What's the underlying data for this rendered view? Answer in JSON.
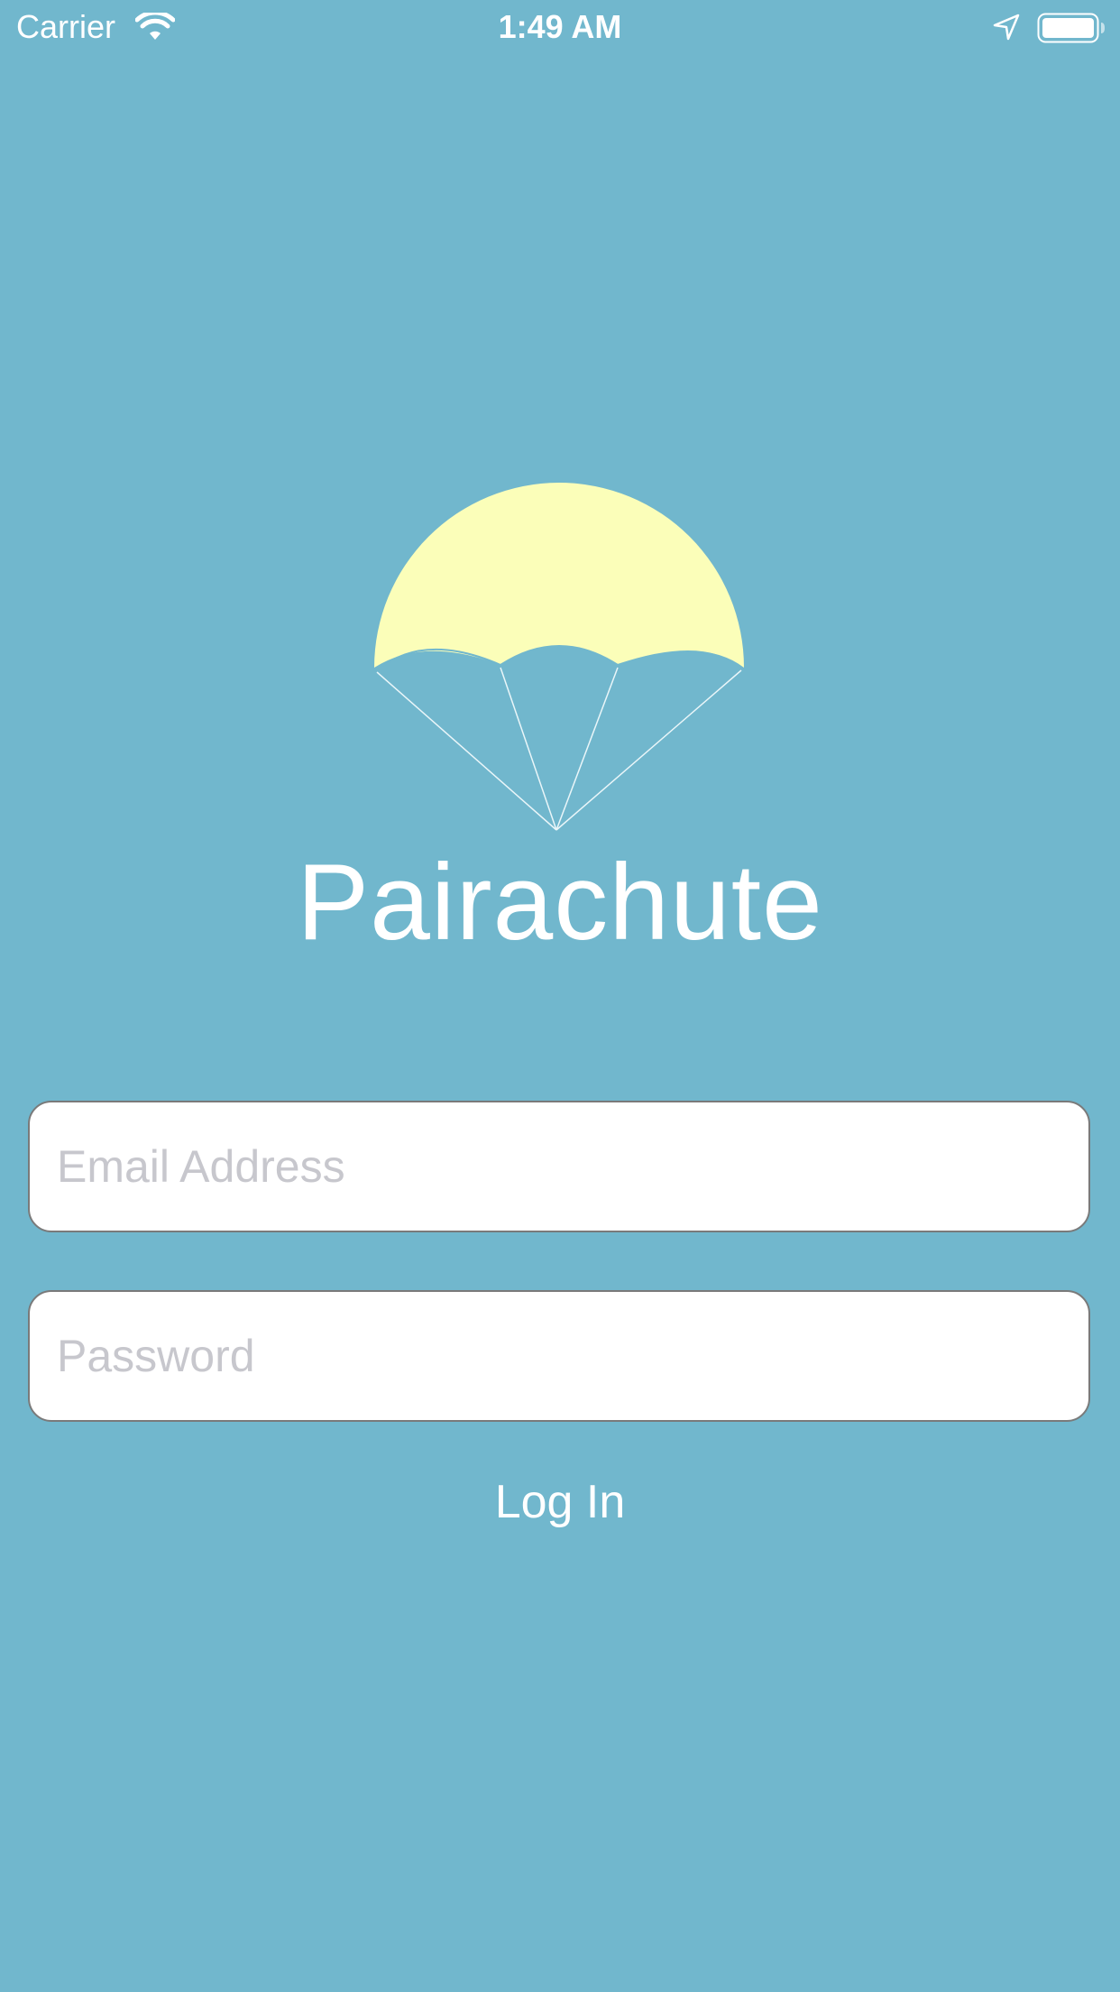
{
  "status_bar": {
    "carrier": "Carrier",
    "time": "1:49 AM",
    "icons": [
      "wifi-icon",
      "location-arrow-icon",
      "battery-icon"
    ]
  },
  "app": {
    "name": "Pairachute",
    "logo_icon": "parachute-logo"
  },
  "form": {
    "email_placeholder": "Email Address",
    "email_value": "",
    "password_placeholder": "Password",
    "password_value": "",
    "login_label": "Log In"
  },
  "colors": {
    "background": "#71b7cd",
    "canopy": "#fbfeb9",
    "text": "#ffffff",
    "placeholder": "#c7c7cd",
    "field_border": "#7a7a7a"
  }
}
